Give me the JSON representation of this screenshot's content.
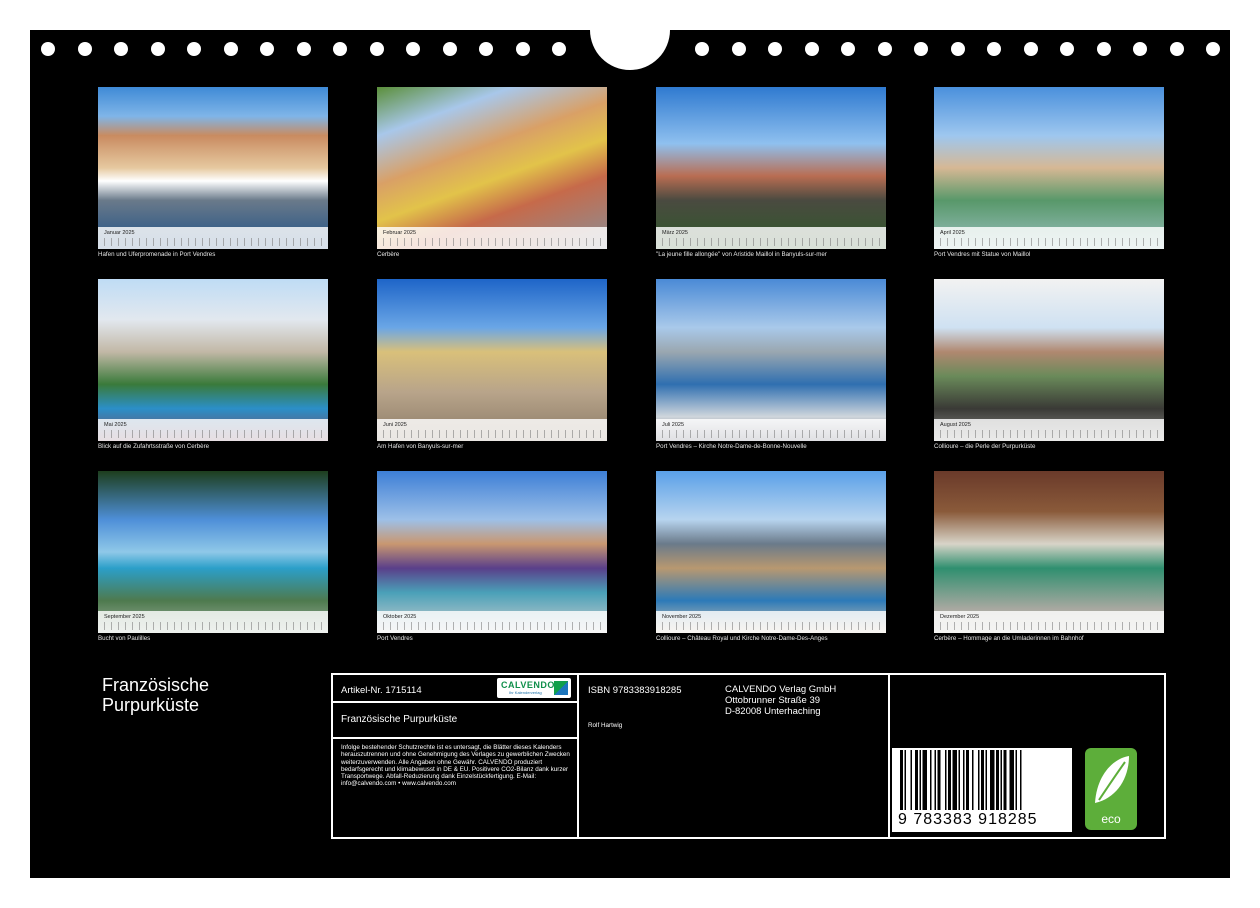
{
  "calendar": {
    "title": "Französische Purpurküste",
    "months": [
      {
        "name": "Januar 2025",
        "caption": "Hafen und Uferpromenade in Port Vendres"
      },
      {
        "name": "Februar 2025",
        "caption": "Cerbère"
      },
      {
        "name": "März 2025",
        "caption": "\"La jeune fille allongée\" von Aristide Maillol in Banyuls-sur-mer"
      },
      {
        "name": "April 2025",
        "caption": "Port Vendres mit Statue von Maillol"
      },
      {
        "name": "Mai 2025",
        "caption": "Blick auf die Zufahrtsstraße von Cerbère"
      },
      {
        "name": "Juni 2025",
        "caption": "Am Hafen von Banyuls-sur-mer"
      },
      {
        "name": "Juli 2025",
        "caption": "Port Vendres – Kirche Notre-Dame-de-Bonne-Nouvelle"
      },
      {
        "name": "August 2025",
        "caption": "Collioure – die Perle der Purpurküste"
      },
      {
        "name": "September 2025",
        "caption": "Bucht von Paulilles"
      },
      {
        "name": "Oktober 2025",
        "caption": "Port Vendres"
      },
      {
        "name": "November 2025",
        "caption": "Collioure – Château Royal und Kirche Notre-Dame-Des-Anges"
      },
      {
        "name": "Dezember 2025",
        "caption": "Cerbère – Hommage an die Umladerinnen im Bahnhof"
      }
    ]
  },
  "info": {
    "article_label": "Artikel-Nr. 1715114",
    "title": "Französische Purpurküste",
    "legal": "Infolge bestehender Schutzrechte ist es untersagt, die Blätter dieses Kalenders herauszutrennen und ohne Genehmigung des Verlages zu gewerblichen Zwecken weiterzuverwenden. Alle Angaben ohne Gewähr. CALVENDO produziert bedarfsgerecht und klimabewusst in DE & EU. Positivere CO2-Bilanz dank kurzer Transportwege. Abfall-Reduzierung dank Einzelstückfertigung. E-Mail: info@calvendo.com • www.calvendo.com",
    "isbn": "ISBN 9783383918285",
    "author": "Rolf Hartwig",
    "publisher_name": "CALVENDO Verlag GmbH",
    "publisher_street": "Ottobrunner Straße 39",
    "publisher_city": "D-82008 Unterhaching",
    "logo_text": "CALVENDO",
    "logo_sub": "Ihr Kalenderverlag",
    "barcode_number": "9 783383 918285",
    "eco_label": "eco"
  }
}
